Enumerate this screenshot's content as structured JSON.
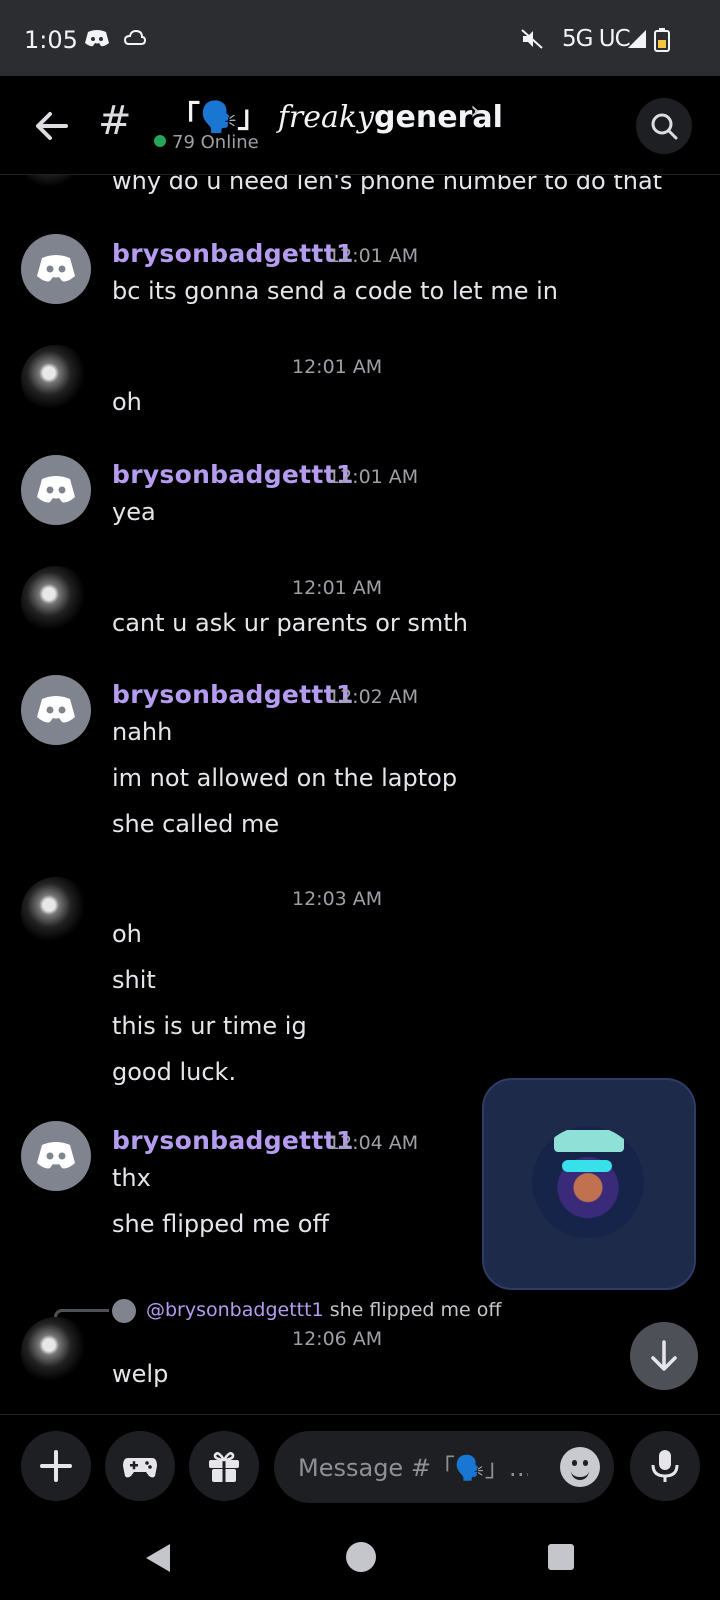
{
  "status_bar": {
    "time": "1:05",
    "network": "5G UC",
    "icons": [
      "discord-icon",
      "cloud-icon",
      "mute-icon",
      "signal-icon",
      "battery-icon"
    ]
  },
  "header": {
    "channel_prefix": "「🗣️」",
    "channel_fancy": "freaky",
    "channel_name": "general",
    "online_text": "79 Online",
    "online_color": "#23a55a"
  },
  "messages": [
    {
      "kind": "continuation",
      "lines": [
        "why do u need len's phone number to do that"
      ]
    },
    {
      "kind": "user",
      "username": "brysonbadgettt1",
      "time": "12:01 AM",
      "lines": [
        "bc its gonna send a code to let me in"
      ]
    },
    {
      "kind": "other",
      "time": "12:01 AM",
      "lines": [
        "oh"
      ]
    },
    {
      "kind": "user",
      "username": "brysonbadgettt1",
      "time": "12:01 AM",
      "lines": [
        "yea"
      ]
    },
    {
      "kind": "other",
      "time": "12:01 AM",
      "lines": [
        "cant u ask ur parents or smth"
      ]
    },
    {
      "kind": "user",
      "username": "brysonbadgettt1",
      "time": "12:02 AM",
      "lines": [
        "nahh",
        "im not allowed on the laptop",
        "she called me"
      ]
    },
    {
      "kind": "other",
      "time": "12:03 AM",
      "lines": [
        "oh",
        "shit",
        "this is ur time ig",
        "good luck."
      ]
    },
    {
      "kind": "user",
      "username": "brysonbadgettt1",
      "time": "12:04 AM",
      "lines": [
        "thx",
        "she flipped me off"
      ]
    },
    {
      "kind": "other",
      "time": "12:06 AM",
      "reply": {
        "mention": "@brysonbadgettt1",
        "snippet": "she flipped me off"
      },
      "lines": [
        "welp"
      ]
    }
  ],
  "composer": {
    "placeholder": "Message #「🗣️」…",
    "buttons": [
      "plus-icon",
      "gamepad-icon",
      "gift-icon",
      "emoji-icon",
      "microphone-icon"
    ]
  },
  "colors": {
    "accent_username": "#b59cf0",
    "background": "#000000",
    "surface": "#1e1f22"
  }
}
